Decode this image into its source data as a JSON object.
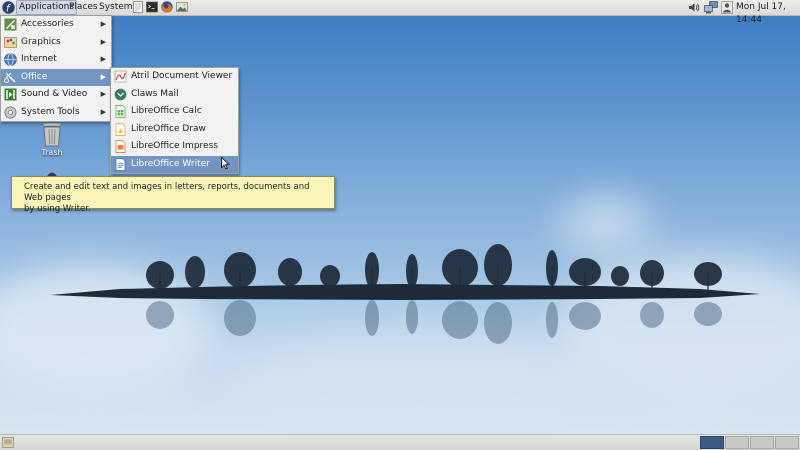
{
  "top_panel": {
    "menus": [
      "Applications",
      "Places",
      "System"
    ],
    "clock": "Mon Jul 17, 14:44"
  },
  "applications_menu": {
    "items": [
      {
        "label": "Accessories",
        "icon": "accessories-icon"
      },
      {
        "label": "Graphics",
        "icon": "graphics-icon"
      },
      {
        "label": "Internet",
        "icon": "internet-icon"
      },
      {
        "label": "Office",
        "icon": "office-icon",
        "highlighted": true
      },
      {
        "label": "Sound & Video",
        "icon": "sound-video-icon"
      },
      {
        "label": "System Tools",
        "icon": "system-tools-icon"
      }
    ]
  },
  "office_submenu": {
    "items": [
      {
        "label": "Atril Document Viewer",
        "icon": "atril-icon"
      },
      {
        "label": "Claws Mail",
        "icon": "claws-mail-icon"
      },
      {
        "label": "LibreOffice Calc",
        "icon": "libreoffice-calc-icon"
      },
      {
        "label": "LibreOffice Draw",
        "icon": "libreoffice-draw-icon"
      },
      {
        "label": "LibreOffice Impress",
        "icon": "libreoffice-impress-icon"
      },
      {
        "label": "LibreOffice Writer",
        "icon": "libreoffice-writer-icon",
        "highlighted": true
      }
    ]
  },
  "tooltip": {
    "line1": "Create and edit text and images in letters, reports, documents and Web pages",
    "line2": "by using Writer."
  },
  "desktop_icons": {
    "trash_label": "Trash"
  },
  "colors": {
    "menu_highlight": "#7395c2",
    "tooltip_bg": "#f9f5b8",
    "active_workspace": "#3e5a7c"
  }
}
